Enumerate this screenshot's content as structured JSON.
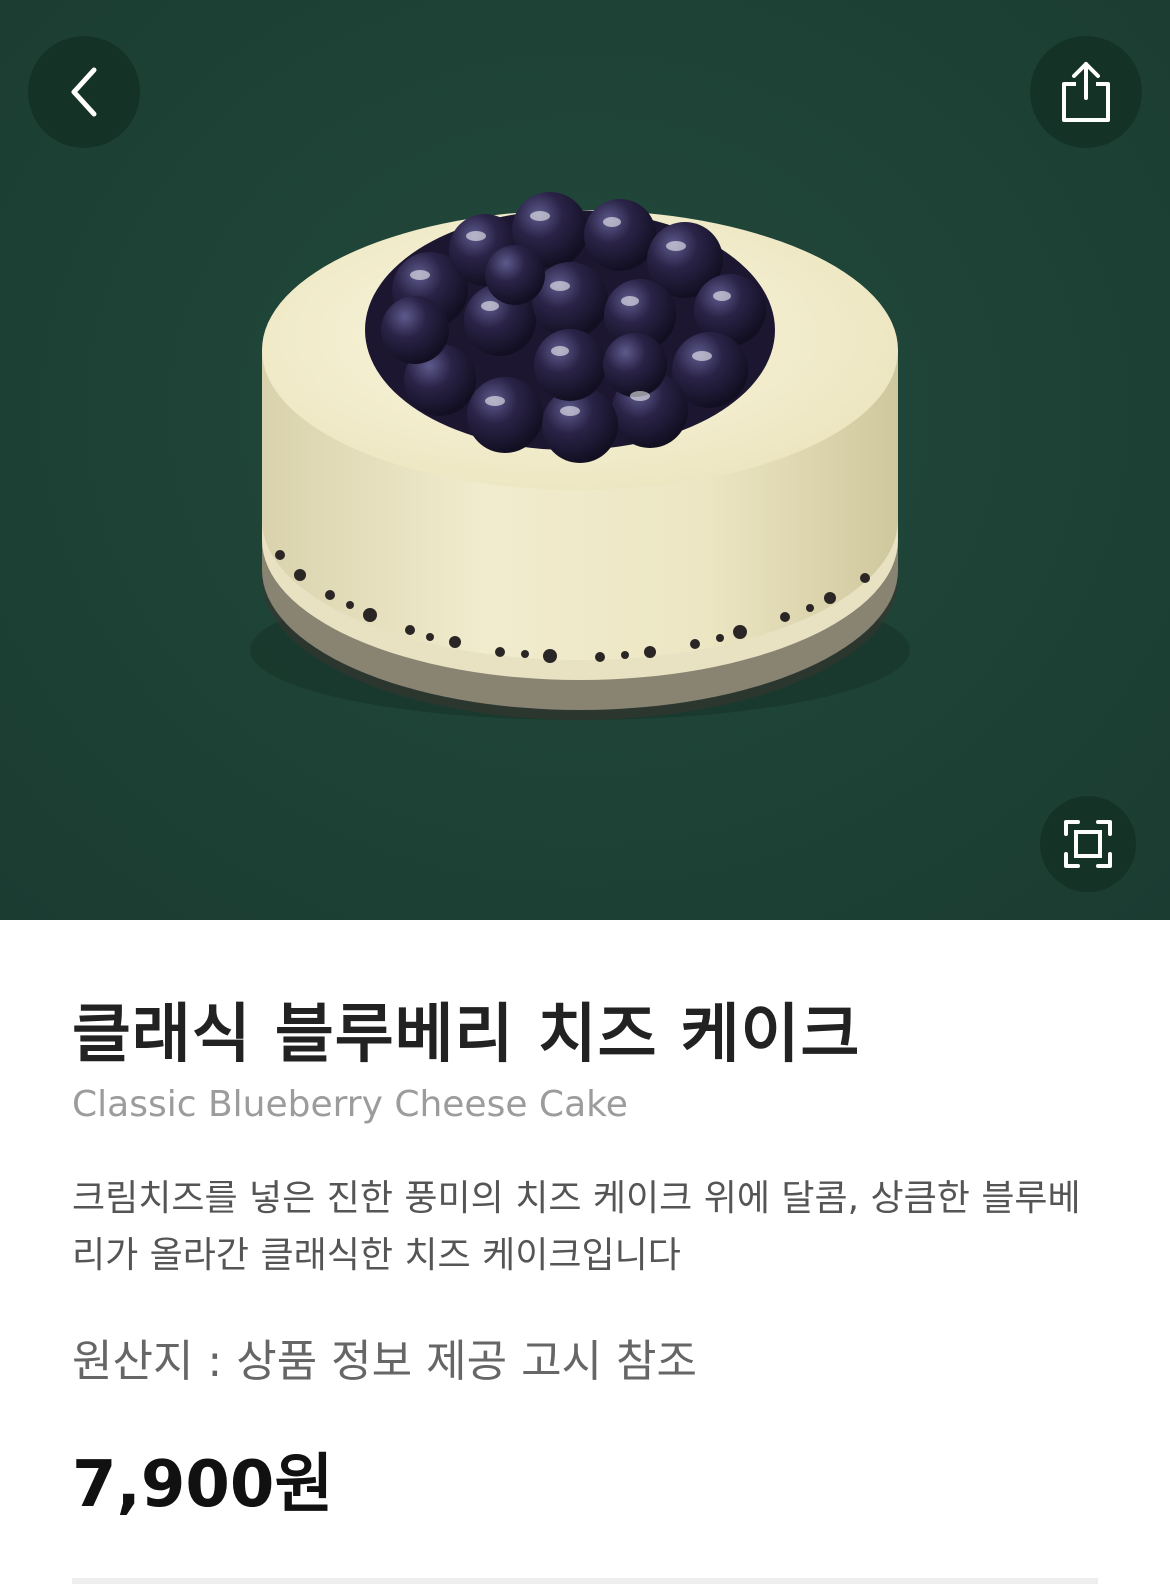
{
  "header": {
    "back_icon": "chevron-left-icon",
    "share_icon": "share-icon",
    "fullscreen_icon": "fullscreen-icon"
  },
  "product": {
    "name_ko": "클래식 블루베리 치즈 케이크",
    "name_en": "Classic Blueberry Cheese Cake",
    "description": "크림치즈를 넣은 진한 풍미의 치즈 케이크 위에 달콤, 상큼한 블루베리가 올라간 클래식한 치즈 케이크입니다",
    "origin": "원산지 : 상품 정보 제공 고시 참조",
    "price": "7,900원"
  },
  "colors": {
    "hero_background": "#1e4236",
    "title": "#222222",
    "subtitle": "#9c9c9c"
  }
}
